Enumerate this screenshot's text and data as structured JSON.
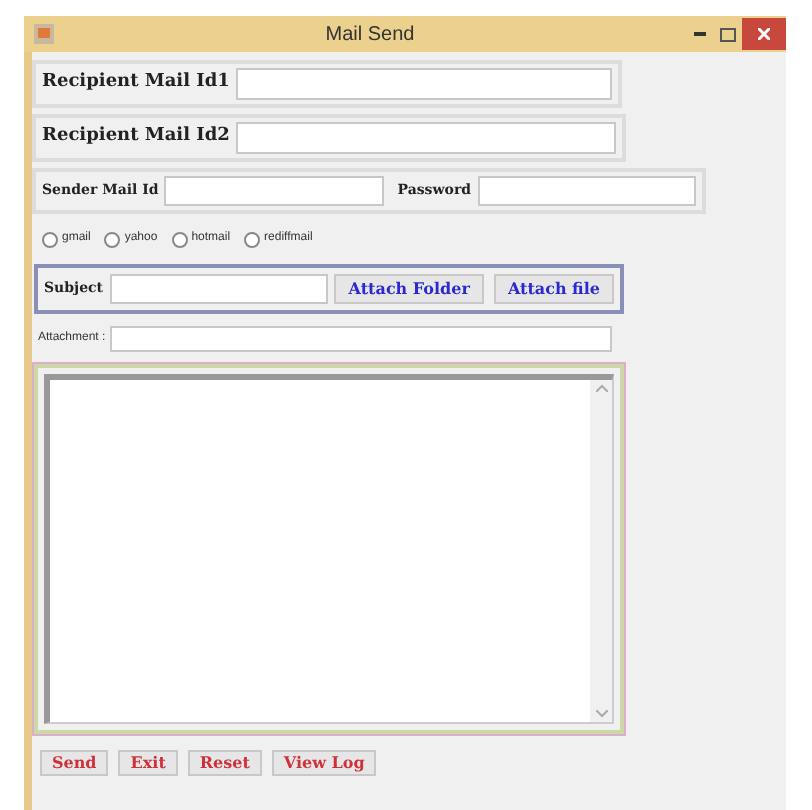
{
  "window": {
    "title": "Mail Send"
  },
  "recipients": [
    {
      "label": "Recipient Mail Id1"
    },
    {
      "label": "Recipient Mail Id2"
    }
  ],
  "sender": {
    "label": "Sender Mail Id"
  },
  "password": {
    "label": "Password"
  },
  "providers": [
    {
      "label": "gmail",
      "selected": false
    },
    {
      "label": "yahoo",
      "selected": false
    },
    {
      "label": "hotmail",
      "selected": false
    },
    {
      "label": "rediffmail",
      "selected": false
    }
  ],
  "subject": {
    "label": "Subject"
  },
  "attach_buttons": [
    "Attach Folder",
    "Attach file"
  ],
  "attachment": {
    "label": "Attachment :"
  },
  "actions": [
    "Send",
    "Exit",
    "Reset",
    "View Log"
  ]
}
